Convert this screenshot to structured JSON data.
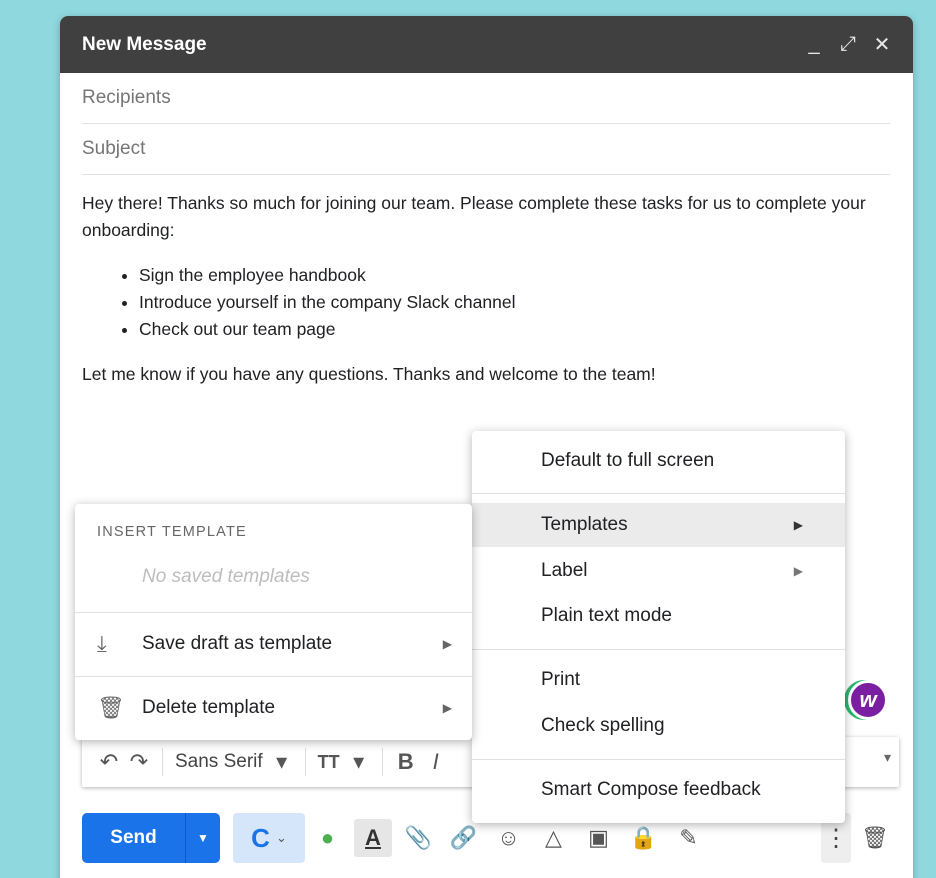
{
  "window": {
    "title": "New Message",
    "minimize_glyph": "_",
    "expand_glyph": "⤢",
    "close_glyph": "✕"
  },
  "fields": {
    "recipients": "Recipients",
    "subject": "Subject"
  },
  "body": {
    "intro": "Hey there! Thanks so much for joining our team. Please complete these tasks for us to complete your onboarding:",
    "tasks": [
      "Sign the employee handbook",
      "Introduce yourself in the company Slack channel",
      "Check out our team page"
    ],
    "closing": "Let me know if you have any questions. Thanks and welcome to the team!"
  },
  "more_menu": {
    "items": [
      {
        "label": "Default to full screen"
      },
      {
        "label": "Templates",
        "submenu": true,
        "highlighted": true
      },
      {
        "label": "Label",
        "submenu": true
      },
      {
        "label": "Plain text mode"
      },
      {
        "label": "Print"
      },
      {
        "label": "Check spelling"
      },
      {
        "label": "Smart Compose feedback"
      }
    ]
  },
  "templates_menu": {
    "heading": "INSERT TEMPLATE",
    "empty": "No saved templates",
    "save_label": "Save draft as template",
    "delete_label": "Delete template"
  },
  "toolbar": {
    "undo_icon": "↶",
    "redo_icon": "↷",
    "font": "Sans Serif",
    "font_caret": "▾",
    "size_icon": "TT",
    "size_caret": "▾",
    "bold": "B",
    "italic": "I",
    "overflow_caret": "▾"
  },
  "bottom": {
    "send_label": "Send",
    "send_menu_caret": "▼",
    "crm_badge": "C",
    "crm_caret": "⌄",
    "text_color_label": "A",
    "attach_glyph": "📎",
    "link_glyph": "🔗",
    "emoji_glyph": "☺",
    "drive_glyph": "△",
    "photo_glyph": "▣",
    "lock_glyph": "🔒",
    "sign_glyph": "✎",
    "more_glyph": "⋮",
    "trash_glyph": "🗑"
  },
  "badge": {
    "letter": "w"
  },
  "colors": {
    "send": "#1a73e8",
    "titlebar": "#404040",
    "background": "#8fd9de",
    "badge": "#7b1fa2"
  }
}
